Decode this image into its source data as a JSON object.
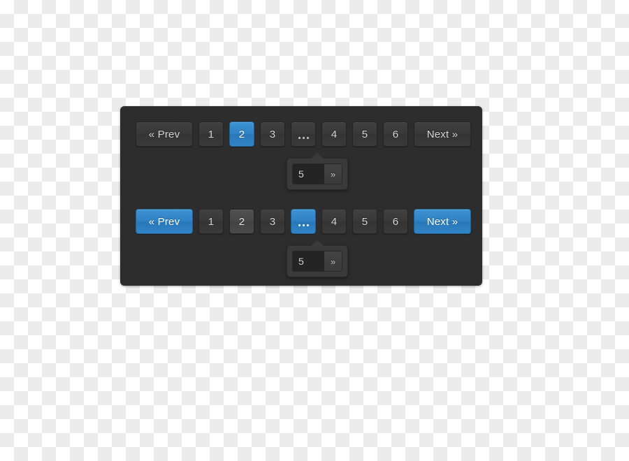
{
  "panel": {
    "background_color": "#2d2d2d"
  },
  "colors": {
    "accent_blue": "#2f82c4",
    "button_gray": "#3a3a3a",
    "hover_gray": "#4a4a4a",
    "text": "#d6d6d6"
  },
  "pagers": [
    {
      "id": "pager-default",
      "items": [
        {
          "name": "prev",
          "label": "« Prev",
          "wide": true,
          "state": "normal"
        },
        {
          "name": "page-1",
          "label": "1",
          "wide": false,
          "state": "normal"
        },
        {
          "name": "page-2",
          "label": "2",
          "wide": false,
          "state": "active"
        },
        {
          "name": "page-3",
          "label": "3",
          "wide": false,
          "state": "normal"
        },
        {
          "name": "ellipsis",
          "label": "...",
          "wide": false,
          "state": "normal"
        },
        {
          "name": "page-4",
          "label": "4",
          "wide": false,
          "state": "normal"
        },
        {
          "name": "page-5",
          "label": "5",
          "wide": false,
          "state": "normal"
        },
        {
          "name": "page-6",
          "label": "6",
          "wide": false,
          "state": "normal"
        },
        {
          "name": "next",
          "label": "Next »",
          "wide": true,
          "state": "normal"
        }
      ],
      "popover": {
        "input_value": "5",
        "input_placeholder": "",
        "go_label": "»"
      }
    },
    {
      "id": "pager-states",
      "items": [
        {
          "name": "prev",
          "label": "« Prev",
          "wide": true,
          "state": "active"
        },
        {
          "name": "page-1",
          "label": "1",
          "wide": false,
          "state": "normal"
        },
        {
          "name": "page-2",
          "label": "2",
          "wide": false,
          "state": "hovered"
        },
        {
          "name": "page-3",
          "label": "3",
          "wide": false,
          "state": "normal"
        },
        {
          "name": "ellipsis",
          "label": "...",
          "wide": false,
          "state": "active"
        },
        {
          "name": "page-4",
          "label": "4",
          "wide": false,
          "state": "normal"
        },
        {
          "name": "page-5",
          "label": "5",
          "wide": false,
          "state": "normal"
        },
        {
          "name": "page-6",
          "label": "6",
          "wide": false,
          "state": "normal"
        },
        {
          "name": "next",
          "label": "Next »",
          "wide": true,
          "state": "active"
        }
      ],
      "popover": {
        "input_value": "5",
        "input_placeholder": "",
        "go_label": "»"
      }
    }
  ]
}
